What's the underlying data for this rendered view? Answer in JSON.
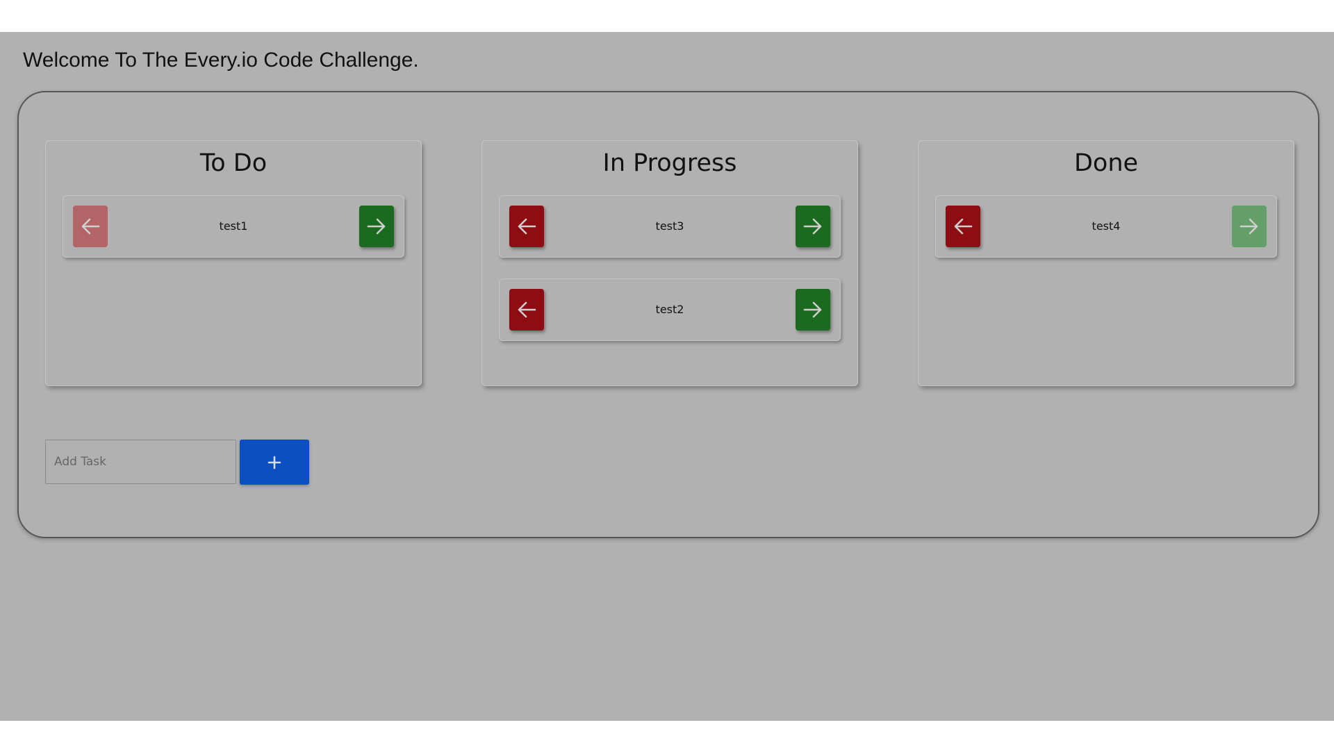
{
  "header": {
    "title": "Welcome To The Every.io Code Challenge."
  },
  "board": {
    "columns": [
      {
        "title": "To Do",
        "tasks": [
          {
            "name": "test1",
            "left_enabled": false,
            "right_enabled": true
          }
        ]
      },
      {
        "title": "In Progress",
        "tasks": [
          {
            "name": "test3",
            "left_enabled": true,
            "right_enabled": true
          },
          {
            "name": "test2",
            "left_enabled": true,
            "right_enabled": true
          }
        ]
      },
      {
        "title": "Done",
        "tasks": [
          {
            "name": "test4",
            "left_enabled": true,
            "right_enabled": false
          }
        ]
      }
    ]
  },
  "add_task": {
    "input_value": "",
    "placeholder": "Add Task",
    "button_icon": "plus-icon"
  },
  "icons": {
    "move_left": "arrow-left-icon",
    "move_right": "arrow-right-icon"
  },
  "colors": {
    "background_overlay": "#b1b1b1",
    "move_left_button": "#8e0d12",
    "move_right_button": "#1c6a1f",
    "add_button": "#0b4fc1"
  }
}
